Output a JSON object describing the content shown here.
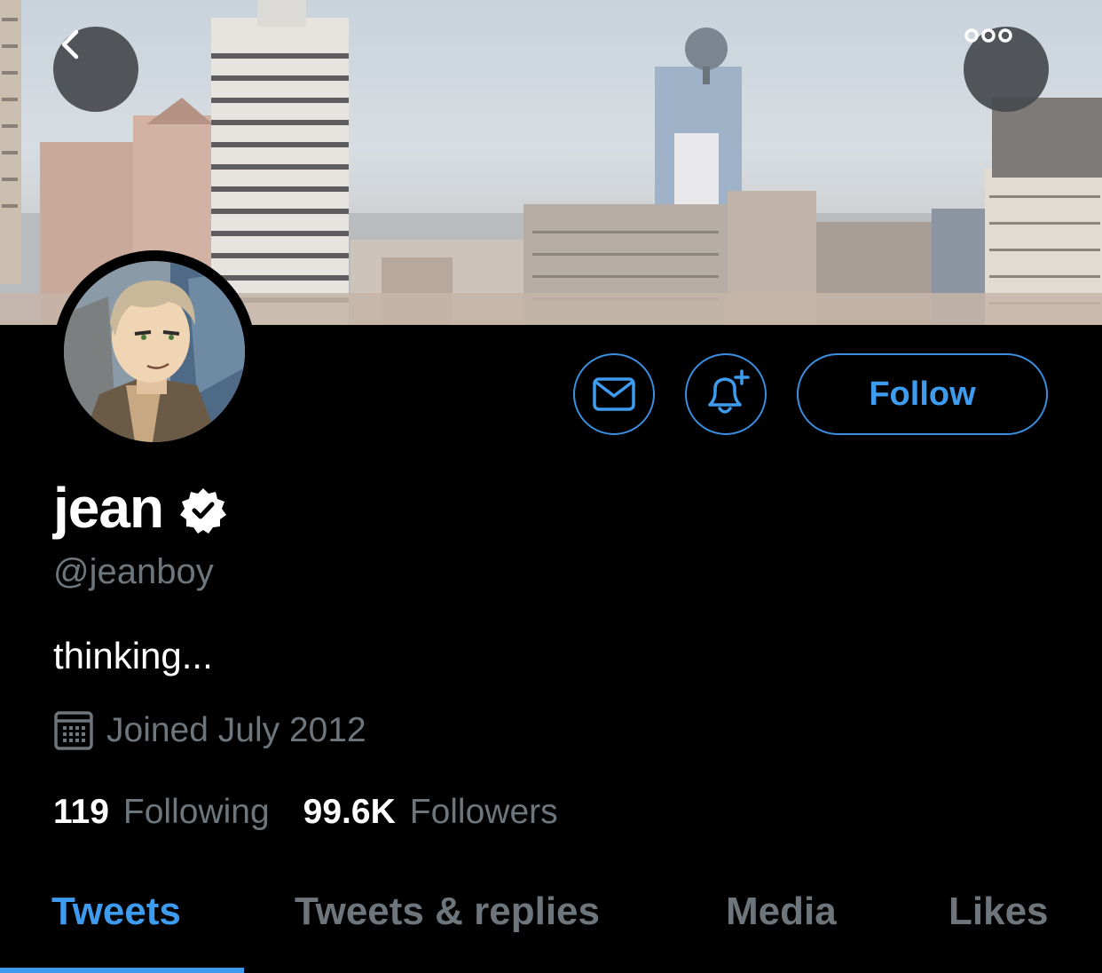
{
  "header": {
    "back_icon": "chevron-left-icon",
    "more_icon": "more-options-icon"
  },
  "profile": {
    "display_name": "jean",
    "verified": true,
    "handle": "@jeanboy",
    "bio": "thinking...",
    "joined": "Joined July 2012",
    "following_count": "119",
    "following_label": "Following",
    "followers_count": "99.6K",
    "followers_label": "Followers"
  },
  "actions": {
    "message_icon": "mail-icon",
    "notify_icon": "bell-plus-icon",
    "follow_label": "Follow"
  },
  "tabs": [
    {
      "label": "Tweets",
      "active": true
    },
    {
      "label": "Tweets & replies",
      "active": false
    },
    {
      "label": "Media",
      "active": false
    },
    {
      "label": "Likes",
      "active": false
    }
  ],
  "colors": {
    "accent": "#3d9cf0",
    "background": "#000000",
    "muted_text": "#6e767d"
  }
}
